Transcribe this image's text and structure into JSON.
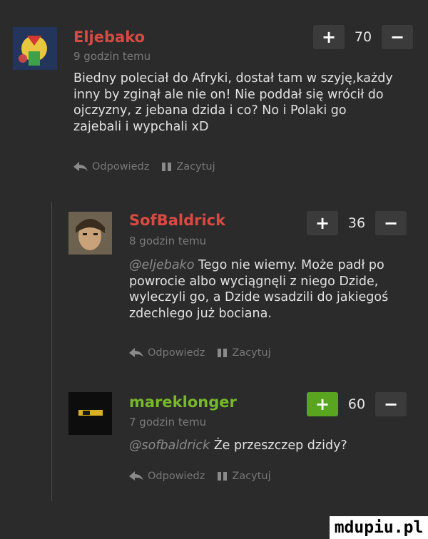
{
  "comments": [
    {
      "username": "Eljebako",
      "username_color": "#d94a43",
      "time": "9 godzin temu",
      "text": "Biedny poleciał do Afryki, dostał tam w szyję,każdy inny by zginął ale nie on! Nie poddał się wrócił do ojczyzny, z jebana dzida i co? No i Polaki go zajebali i wypchali xD",
      "votes": "70",
      "upvote_label": "+",
      "downvote_label": "−",
      "reply_label": "Odpowiedz",
      "quote_label": "Zacytuj",
      "reply_icon": "reply-arrow-icon",
      "quote_icon": "quote-icon"
    },
    {
      "username": "SofBaldrick",
      "username_color": "#d94a43",
      "time": "8 godzin temu",
      "mention": "@eljebako",
      "text": "Tego nie wiemy. Może padł po powrocie albo wyciągnęli z niego Dzide, wyleczyli go, a Dzide wsadzili do jakiegoś zdechlego już bociana.",
      "votes": "36",
      "upvote_label": "+",
      "downvote_label": "−",
      "reply_label": "Odpowiedz",
      "quote_label": "Zacytuj"
    },
    {
      "username": "mareklonger",
      "username_color": "#76b82a",
      "time": "7 godzin temu",
      "mention": "@sofbaldrick",
      "text": "Że przeszczep dzidy?",
      "votes": "60",
      "upvote_active": true,
      "upvote_label": "+",
      "downvote_label": "−",
      "reply_label": "Odpowiedz",
      "quote_label": "Zacytuj"
    }
  ],
  "watermark": "mdupiu.pl",
  "colors": {
    "background": "#2b2b2b",
    "button": "#3b3b3b",
    "active_vote": "#5aa520"
  }
}
